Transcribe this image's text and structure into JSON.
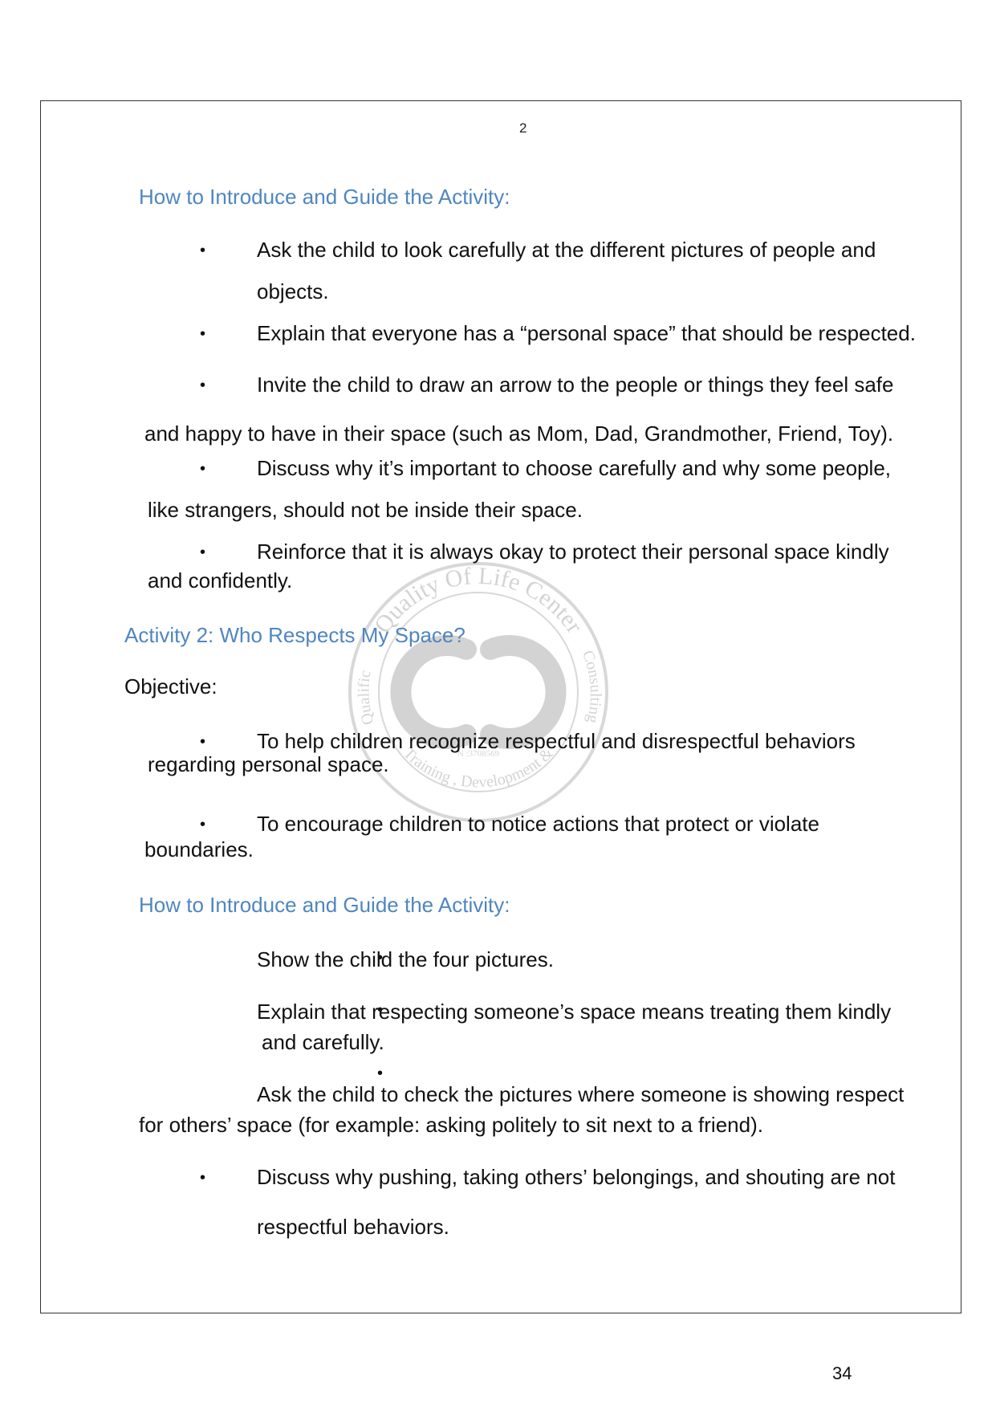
{
  "inner_page_number": "2",
  "footer_page_number": "34",
  "section1": {
    "heading": "How to Introduce and Guide the Activity:",
    "lines": [
      "Ask the child to look carefully at the different pictures of people and",
      "objects.",
      "Explain that everyone has a “personal space” that should be respected.",
      "Invite the child to draw an arrow to the people or things they feel safe",
      "and happy to have in their space (such as Mom, Dad, Grandmother, Friend, Toy).",
      "Discuss why it’s important to choose carefully and why some people,",
      "like strangers, should not be inside their space.",
      "Reinforce that it is always okay to protect their personal space kindly",
      "and confidently."
    ]
  },
  "activity2": {
    "title": "Activity 2: Who Respects My Space?",
    "objective_label": "Objective:",
    "objective_lines": [
      "To help children recognize respectful and disrespectful behaviors",
      "regarding personal space.",
      "To encourage children to notice actions that protect or violate",
      "boundaries."
    ]
  },
  "section2": {
    "heading": "How to Introduce and Guide the Activity:",
    "lines": [
      "Show the child the four pictures.",
      "Explain that respecting someone’s space means treating them kindly",
      "and carefully.",
      "Ask the child to check the pictures where someone is showing respect",
      "for others’ space (for example: asking politely to sit next to a friend).",
      "Discuss why pushing, taking others’ belongings, and shouting are not",
      "respectful behaviors."
    ]
  },
  "bullet_char": "•",
  "watermark": {
    "top_text": "Quality Of Life Center",
    "left_text": "Qualific",
    "right_text": "Consulting",
    "bottom_text": "Training , Development &",
    "number": "N :3708569"
  }
}
